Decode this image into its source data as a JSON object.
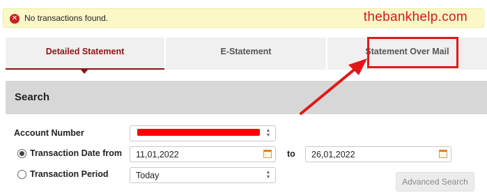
{
  "alert": {
    "icon": "error-circle-icon",
    "message": "No transactions found.",
    "watermark": "thebankhelp.com"
  },
  "tabs": [
    {
      "label": "Detailed Statement",
      "active": true
    },
    {
      "label": "E-Statement",
      "active": false
    },
    {
      "label": "Statement Over Mail",
      "active": false
    }
  ],
  "search": {
    "title": "Search",
    "account_number_label": "Account Number",
    "account_number_value": "",
    "date_from_label": "Transaction Date from",
    "date_from_value": "11,01,2022",
    "to_label": "to",
    "date_to_value": "26,01,2022",
    "period_label": "Transaction Period",
    "period_value": "Today",
    "advanced_button": "Advanced Search",
    "selected_mode": "Transaction Date from"
  },
  "colors": {
    "accent": "#8c1414",
    "annotation": "#e01818",
    "alert_bg": "#fbf8c8",
    "panel_header": "#d7d7d7"
  }
}
